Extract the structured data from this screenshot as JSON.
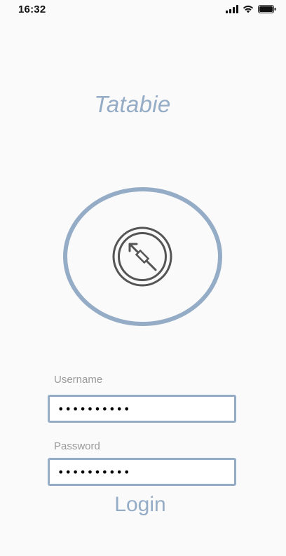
{
  "status_bar": {
    "time": "16:32",
    "icons": [
      "signal-icon",
      "wifi-icon",
      "battery-icon"
    ]
  },
  "app": {
    "title": "Tatabie"
  },
  "center_control": {
    "icon": "fingerprint-icon"
  },
  "form": {
    "username_label": "Username",
    "username_value": "••••••••••",
    "password_label": "Password",
    "password_value": "••••••••••"
  },
  "login": {
    "label": "Login"
  },
  "colors": {
    "accent": "#95acc7",
    "label": "#9a9a9a",
    "background": "#fafafa",
    "icon": "#555555"
  }
}
